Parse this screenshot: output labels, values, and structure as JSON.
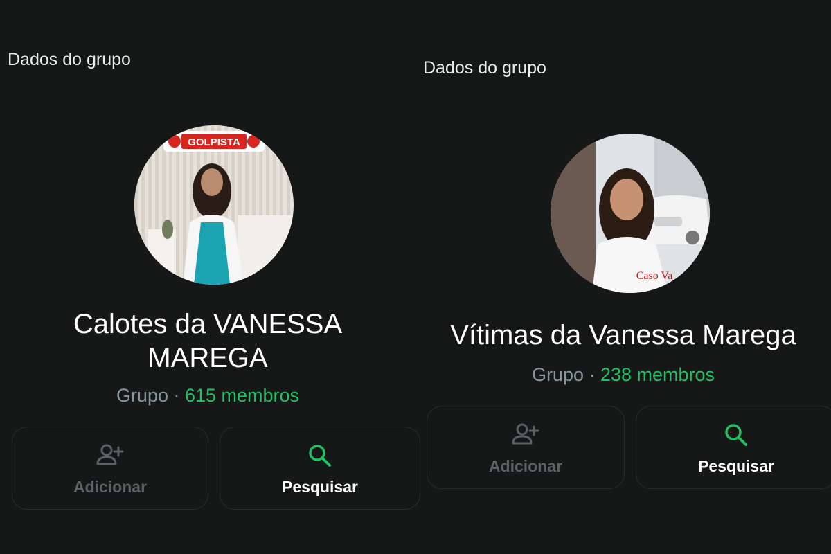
{
  "panels": [
    {
      "header_title": "Dados do grupo",
      "group_name": "Calotes da VANESSA MAREGA",
      "group_type": "Grupo",
      "separator": " · ",
      "members": "615 membros",
      "avatar_badge": "GOLPISTA",
      "add_label": "Adicionar",
      "search_label": "Pesquisar"
    },
    {
      "header_title": "Dados do grupo",
      "group_name": "Vítimas da Vanessa Marega",
      "group_type": "Grupo",
      "separator": " · ",
      "members": "238 membros",
      "avatar_caption": "Caso Va",
      "add_label": "Adicionar",
      "search_label": "Pesquisar"
    }
  ],
  "colors": {
    "background": "#161717",
    "accent": "#21c063",
    "muted": "#8696a0",
    "disabled": "#5b6166"
  },
  "icons": {
    "add": "add-person-icon",
    "search": "search-icon"
  }
}
